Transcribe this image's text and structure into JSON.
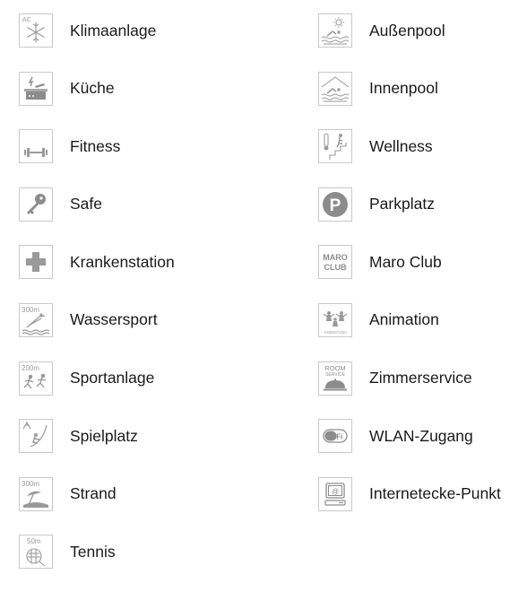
{
  "left": [
    {
      "label": "Klimaanlage",
      "icon": "air-conditioning-icon",
      "tag": "AC"
    },
    {
      "label": "Küche",
      "icon": "kitchen-icon"
    },
    {
      "label": "Fitness",
      "icon": "dumbbell-icon"
    },
    {
      "label": "Safe",
      "icon": "key-icon"
    },
    {
      "label": "Krankenstation",
      "icon": "medical-cross-icon"
    },
    {
      "label": "Wassersport",
      "icon": "watersport-icon",
      "tag": "300m"
    },
    {
      "label": "Sportanlage",
      "icon": "sport-facility-icon",
      "tag": "200m"
    },
    {
      "label": "Spielplatz",
      "icon": "playground-icon"
    },
    {
      "label": "Strand",
      "icon": "beach-icon",
      "tag": "300m"
    },
    {
      "label": "Tennis",
      "icon": "tennis-icon",
      "tag": "50m"
    }
  ],
  "right": [
    {
      "label": "Außenpool",
      "icon": "outdoor-pool-icon"
    },
    {
      "label": "Innenpool",
      "icon": "indoor-pool-icon"
    },
    {
      "label": "Wellness",
      "icon": "wellness-icon"
    },
    {
      "label": "Parkplatz",
      "icon": "parking-icon",
      "tag": "P"
    },
    {
      "label": "Maro Club",
      "icon": "maro-club-icon",
      "tag1": "MARO",
      "tag2": "CLUB"
    },
    {
      "label": "Animation",
      "icon": "animation-icon",
      "tag": "ANIMATION"
    },
    {
      "label": "Zimmerservice",
      "icon": "room-service-icon",
      "tag1": "ROOM",
      "tag2": "SERVICE"
    },
    {
      "label": "WLAN-Zugang",
      "icon": "wifi-icon",
      "tag": "WiFi"
    },
    {
      "label": "Internetecke-Punkt",
      "icon": "internet-corner-icon",
      "tag": "@"
    }
  ]
}
